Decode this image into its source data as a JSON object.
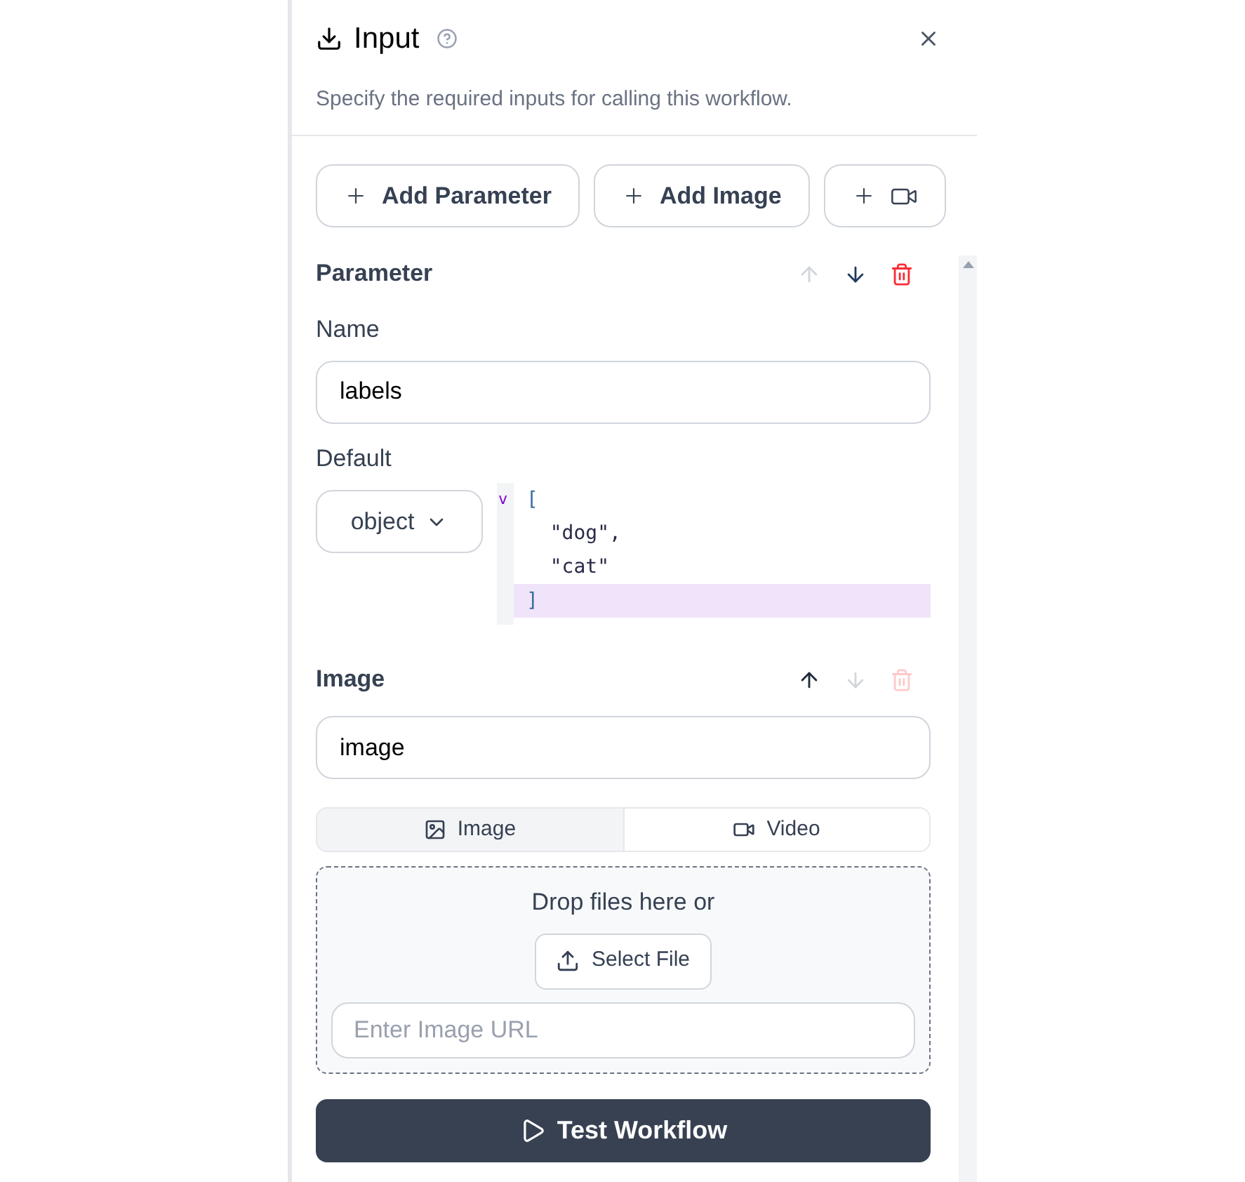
{
  "header": {
    "title": "Input",
    "description": "Specify the required inputs for calling this workflow."
  },
  "add_buttons": [
    {
      "kind": "parameter",
      "label": "Add Parameter"
    },
    {
      "kind": "image",
      "label": "Add Image"
    },
    {
      "kind": "video"
    }
  ],
  "inputs": [
    {
      "kind": "parameter",
      "title": "Parameter",
      "actions": [
        {
          "kind": "up",
          "disabled": true
        },
        {
          "kind": "down",
          "disabled": false
        },
        {
          "kind": "delete",
          "disabled": false
        }
      ],
      "name_label": "Name",
      "name_value": "labels",
      "default_label": "Default",
      "type_select": "object",
      "fold_marker": "v",
      "code_lines": [
        {
          "text": "[",
          "foldable": true,
          "active": false
        },
        {
          "text": "  \"dog\",",
          "foldable": false,
          "active": false
        },
        {
          "text": "  \"cat\"",
          "foldable": false,
          "active": false
        },
        {
          "text": "]",
          "foldable": false,
          "active": true
        }
      ]
    },
    {
      "kind": "image",
      "title": "Image",
      "actions": [
        {
          "kind": "up",
          "disabled": false
        },
        {
          "kind": "down",
          "disabled": true
        },
        {
          "kind": "delete",
          "disabled": true
        }
      ],
      "name_value": "image",
      "tabs": [
        {
          "kind": "image",
          "label": "Image",
          "selected": true
        },
        {
          "kind": "video",
          "label": "Video",
          "selected": false
        }
      ],
      "dropzone": {
        "text": "Drop files here or",
        "button": "Select File",
        "url_placeholder": "Enter Image URL"
      }
    }
  ],
  "run_button": "Test Workflow"
}
